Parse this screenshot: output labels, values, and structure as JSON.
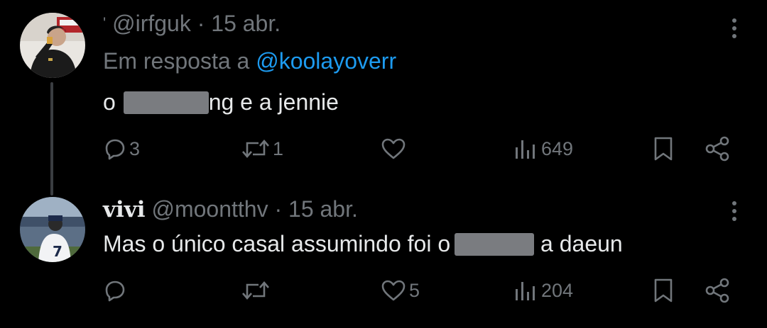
{
  "tweets": [
    {
      "handle_prefix": "'",
      "handle": "@irfguk",
      "separator": " · ",
      "date": "15 abr.",
      "reply_label": "Em resposta a",
      "reply_mention": "@koolayoverr",
      "text_before": "o",
      "text_after": "ng e a jennie",
      "stats": {
        "replies": "3",
        "reposts": "1",
        "likes": "",
        "views": "649"
      }
    },
    {
      "display_name": "vivi",
      "handle": "@moontthv",
      "separator": " · ",
      "date": "15 abr.",
      "text_before": "Mas o único casal assumindo foi o",
      "text_after": " a daeun",
      "stats": {
        "replies": "",
        "reposts": "",
        "likes": "5",
        "views": "204"
      }
    }
  ],
  "icons": {
    "reply": "reply-icon",
    "repost": "repost-icon",
    "like": "heart-icon",
    "views": "views-icon",
    "bookmark": "bookmark-icon",
    "share": "share-icon",
    "more": "more-icon"
  },
  "colors": {
    "background": "#000000",
    "text": "#e7e9ea",
    "muted": "#71767b",
    "link": "#1d9bf0"
  }
}
